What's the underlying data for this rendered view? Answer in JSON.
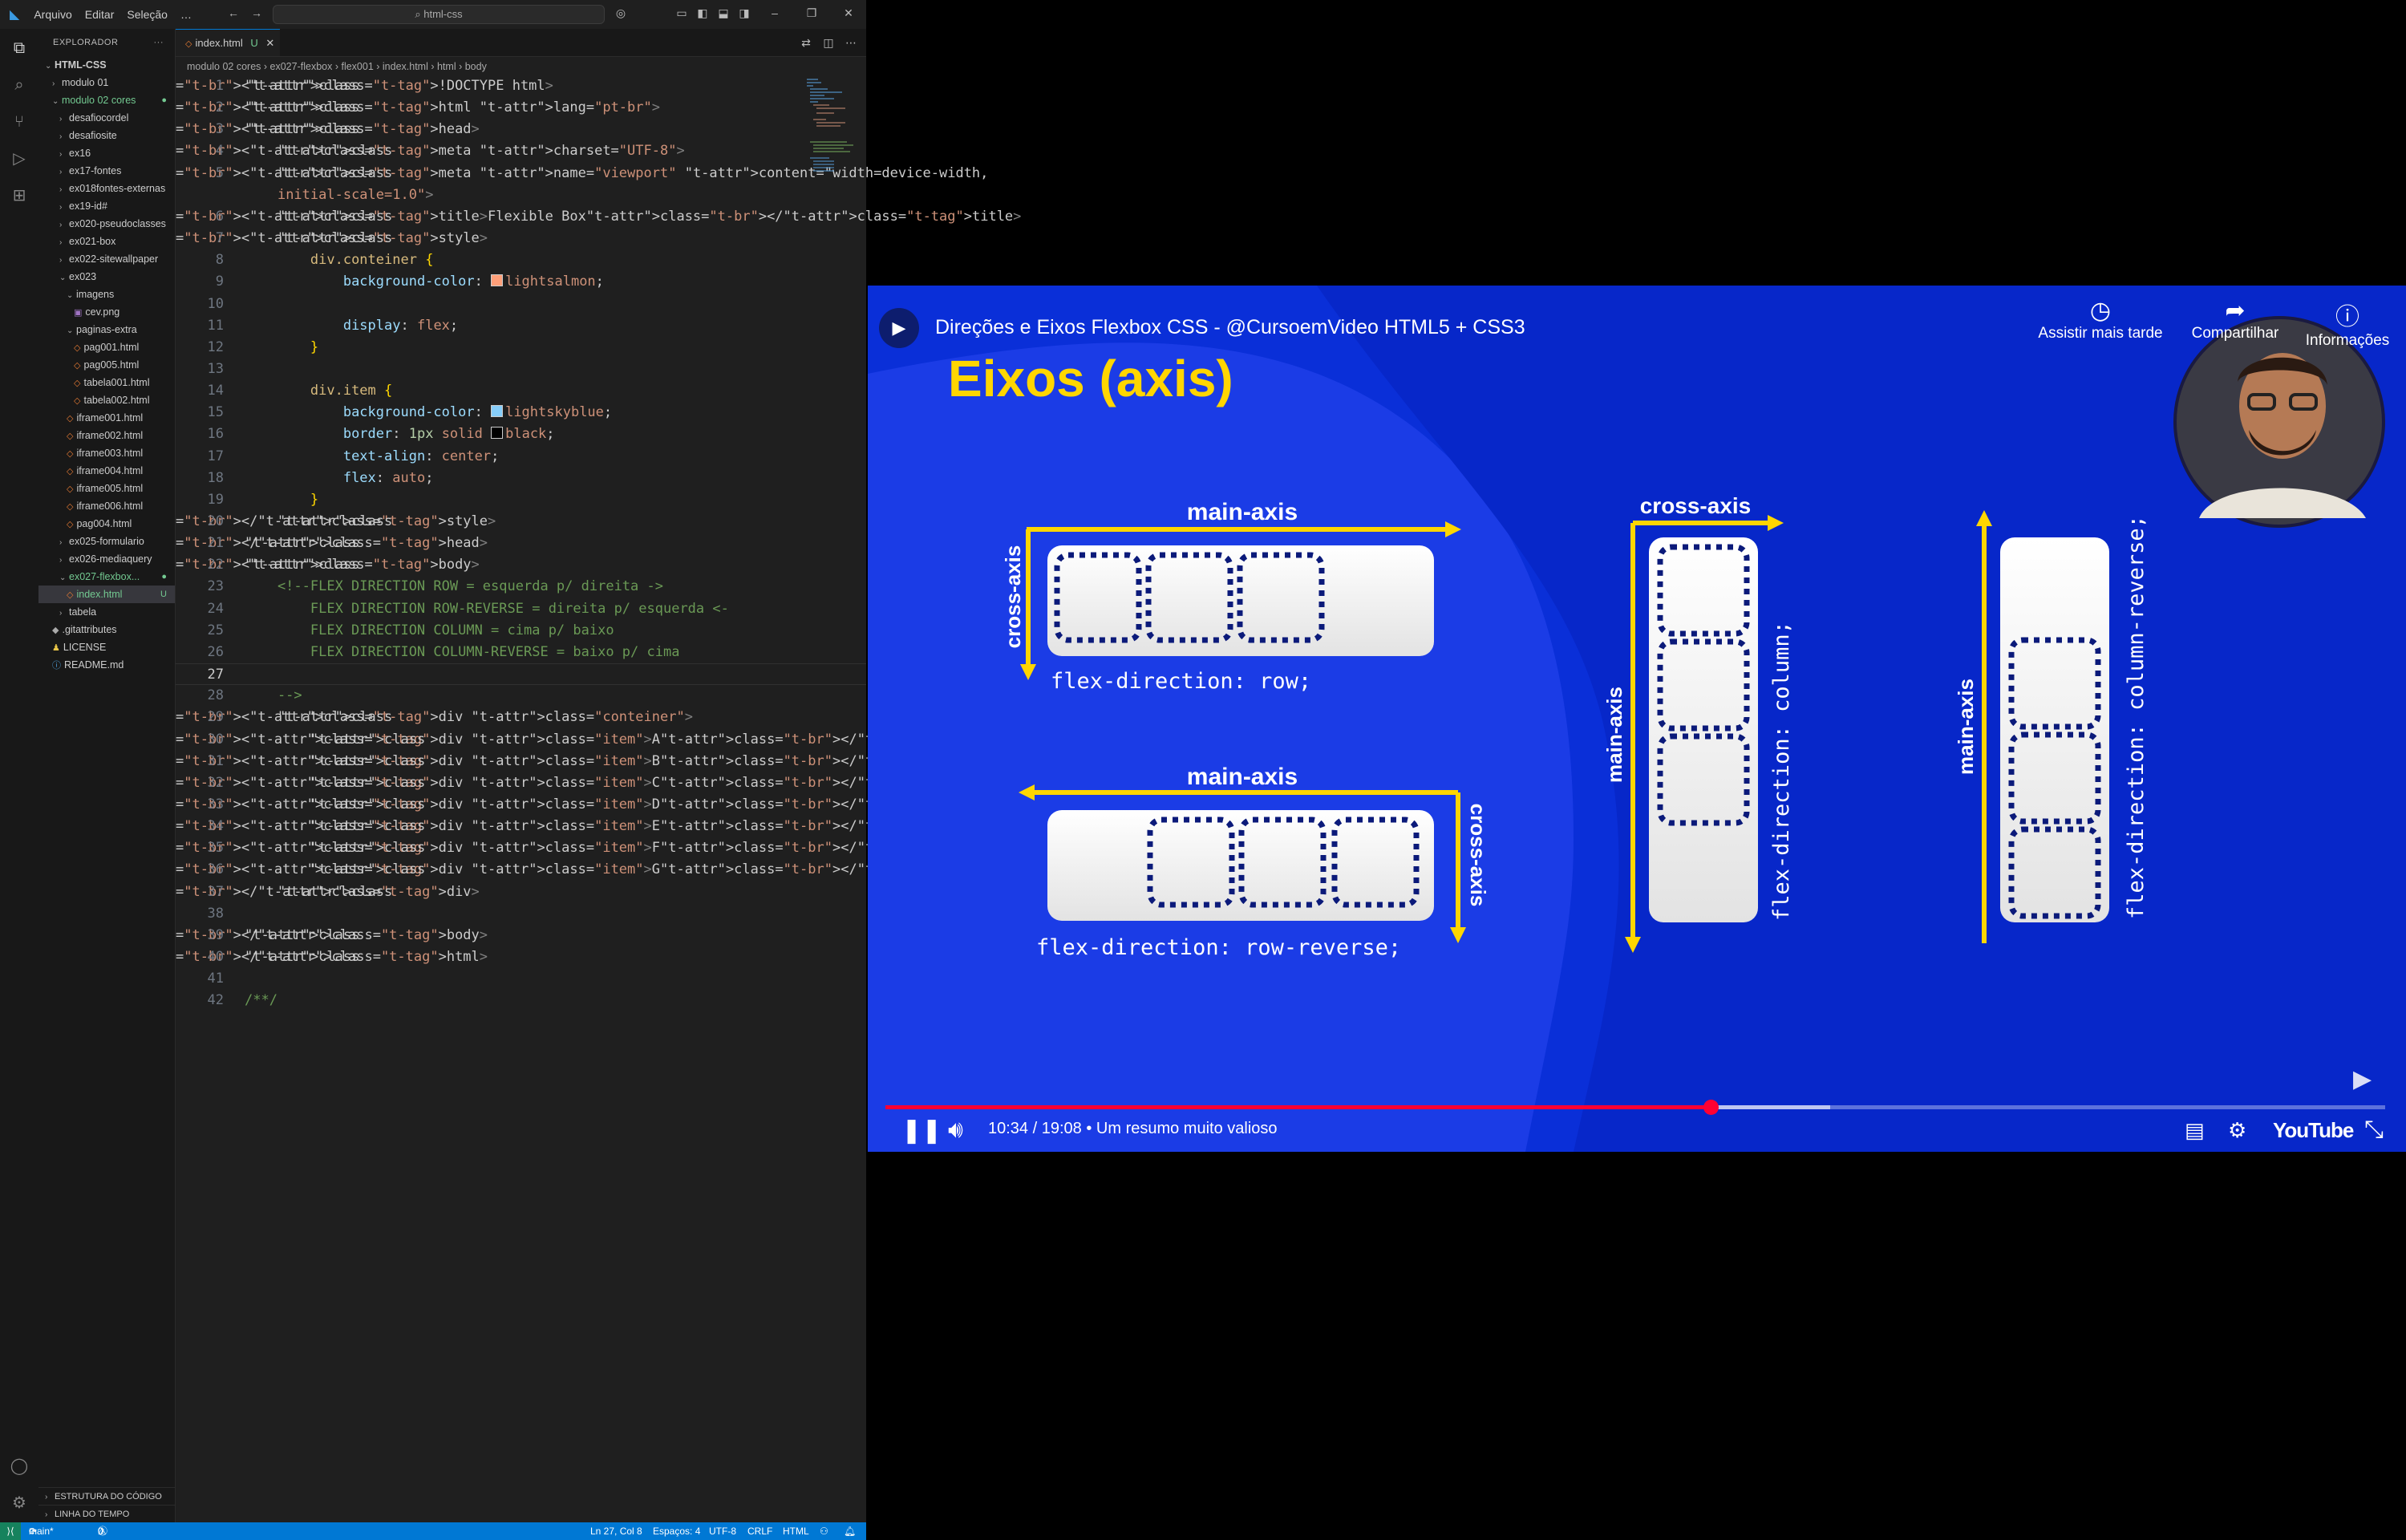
{
  "vscode": {
    "menu": [
      "Arquivo",
      "Editar",
      "Seleção",
      "…"
    ],
    "search_placeholder": "html-css",
    "sidebar_title": "EXPLORADOR",
    "tree": [
      {
        "label": "HTML-CSS",
        "depth": 0,
        "kind": "root",
        "open": true
      },
      {
        "label": "modulo 01",
        "depth": 1,
        "kind": "folder"
      },
      {
        "label": "modulo 02 cores",
        "depth": 1,
        "kind": "folder",
        "open": true,
        "modified": true
      },
      {
        "label": "desafiocordel",
        "depth": 2,
        "kind": "folder"
      },
      {
        "label": "desafiosite",
        "depth": 2,
        "kind": "folder"
      },
      {
        "label": "ex16",
        "depth": 2,
        "kind": "folder"
      },
      {
        "label": "ex17-fontes",
        "depth": 2,
        "kind": "folder"
      },
      {
        "label": "ex018fontes-externas",
        "depth": 2,
        "kind": "folder"
      },
      {
        "label": "ex19-id#",
        "depth": 2,
        "kind": "folder"
      },
      {
        "label": "ex020-pseudoclasses",
        "depth": 2,
        "kind": "folder"
      },
      {
        "label": "ex021-box",
        "depth": 2,
        "kind": "folder"
      },
      {
        "label": "ex022-sitewallpaper",
        "depth": 2,
        "kind": "folder"
      },
      {
        "label": "ex023",
        "depth": 2,
        "kind": "folder",
        "open": true
      },
      {
        "label": "imagens",
        "depth": 3,
        "kind": "folder",
        "open": true
      },
      {
        "label": "cev.png",
        "depth": 4,
        "kind": "image"
      },
      {
        "label": "paginas-extra",
        "depth": 3,
        "kind": "folder",
        "open": true
      },
      {
        "label": "pag001.html",
        "depth": 4,
        "kind": "html"
      },
      {
        "label": "pag005.html",
        "depth": 4,
        "kind": "html"
      },
      {
        "label": "tabela001.html",
        "depth": 4,
        "kind": "html"
      },
      {
        "label": "tabela002.html",
        "depth": 4,
        "kind": "html"
      },
      {
        "label": "iframe001.html",
        "depth": 3,
        "kind": "html"
      },
      {
        "label": "iframe002.html",
        "depth": 3,
        "kind": "html"
      },
      {
        "label": "iframe003.html",
        "depth": 3,
        "kind": "html"
      },
      {
        "label": "iframe004.html",
        "depth": 3,
        "kind": "html"
      },
      {
        "label": "iframe005.html",
        "depth": 3,
        "kind": "html"
      },
      {
        "label": "iframe006.html",
        "depth": 3,
        "kind": "html"
      },
      {
        "label": "pag004.html",
        "depth": 3,
        "kind": "html"
      },
      {
        "label": "ex025-formulario",
        "depth": 2,
        "kind": "folder"
      },
      {
        "label": "ex026-mediaquery",
        "depth": 2,
        "kind": "folder"
      },
      {
        "label": "ex027-flexbox...",
        "depth": 2,
        "kind": "folder",
        "open": true,
        "modified": true
      },
      {
        "label": "index.html",
        "depth": 3,
        "kind": "html",
        "selected": true,
        "badge": "U"
      },
      {
        "label": "tabela",
        "depth": 2,
        "kind": "folder"
      },
      {
        "label": ".gitattributes",
        "depth": 1,
        "kind": "git"
      },
      {
        "label": "LICENSE",
        "depth": 1,
        "kind": "license"
      },
      {
        "label": "README.md",
        "depth": 1,
        "kind": "info"
      }
    ],
    "bottom_sections": [
      "ESTRUTURA DO CÓDIGO",
      "LINHA DO TEMPO"
    ],
    "tab": {
      "label": "index.html",
      "badge": "U"
    },
    "breadcrumb": [
      "modulo 02 cores",
      "ex027-flexbox",
      "flex001",
      "index.html",
      "html",
      "body"
    ],
    "code_lines": [
      "<!DOCTYPE html>",
      "<html lang=\"pt-br\">",
      "<head>",
      "    <meta charset=\"UTF-8\">",
      "    <meta name=\"viewport\" content=\"width=device-width,",
      "    initial-scale=1.0\">",
      "    <title>Flexible Box</title>",
      "    <style>",
      "        div.conteiner {",
      "            background-color: lightsalmon;",
      "",
      "            display: flex;",
      "        }",
      "",
      "        div.item {",
      "            background-color: lightskyblue;",
      "            border: 1px solid black;",
      "            text-align: center;",
      "            flex: auto;",
      "        }",
      "    </style>",
      "</head>",
      "<body>",
      "    <!--FLEX DIRECTION ROW = esquerda p/ direita ->",
      "        FLEX DIRECTION ROW-REVERSE = direita p/ esquerda <-",
      "        FLEX DIRECTION COLUMN = cima p/ baixo",
      "        FLEX DIRECTION COLUMN-REVERSE = baixo p/ cima",
      "",
      "    -->",
      "    <div class=\"conteiner\">",
      "        <div class=\"item\">A</div>",
      "        <div class=\"item\">B</div>",
      "        <div class=\"item\">C</div>",
      "        <div class=\"item\">D</div>",
      "        <div class=\"item\">E</div>",
      "        <div class=\"item\">F</div>",
      "        <div class=\"item\">G</div>",
      "    </div>",
      "",
      "</body>",
      "</html>",
      "",
      "/**/"
    ],
    "line_numbers": [
      "1",
      "2",
      "3",
      "4",
      "5",
      "",
      "6",
      "7",
      "8",
      "9",
      "10",
      "11",
      "12",
      "13",
      "14",
      "15",
      "16",
      "17",
      "18",
      "19",
      "20",
      "21",
      "22",
      "23",
      "24",
      "25",
      "26",
      "27",
      "28",
      "29",
      "30",
      "31",
      "32",
      "33",
      "34",
      "35",
      "36",
      "37",
      "38",
      "39",
      "40",
      "41",
      "42"
    ],
    "current_line": 27,
    "status": {
      "branch": "main*",
      "problems": "0",
      "warnings": "0",
      "position": "Ln 27, Col 8",
      "spaces": "Espaços: 4",
      "encoding": "UTF-8",
      "eol": "CRLF",
      "language": "HTML"
    },
    "colors": {
      "accent": "#0078d4",
      "modified": "#73c991",
      "salmon": "#ffa07a",
      "skyblue": "#87cefa"
    }
  },
  "video": {
    "title": "Direções e Eixos Flexbox CSS - @CursoemVideo HTML5 + CSS3",
    "buttons": [
      {
        "label": "Assistir mais tarde",
        "icon": "clock-icon"
      },
      {
        "label": "Compartilhar",
        "icon": "share-icon"
      },
      {
        "label": "Informações",
        "icon": "info-icon"
      }
    ],
    "slide": {
      "heading": "Eixos (axis)",
      "labels": {
        "main_axis": "main-axis",
        "cross_axis": "cross-axis",
        "row": "flex-direction: row;",
        "row_reverse": "flex-direction: row-reverse;",
        "column": "flex-direction: column;",
        "column_reverse": "flex-direction: column-reverse;"
      }
    },
    "time": "10:34 / 19:08",
    "chapter": "• Um resumo muito valioso",
    "progress": 0.55,
    "buffered": 0.63,
    "brand": "YouTube",
    "colors": {
      "bg": "#0a2fd8",
      "yellow": "#ffd600",
      "progress": "#ff0033"
    }
  }
}
